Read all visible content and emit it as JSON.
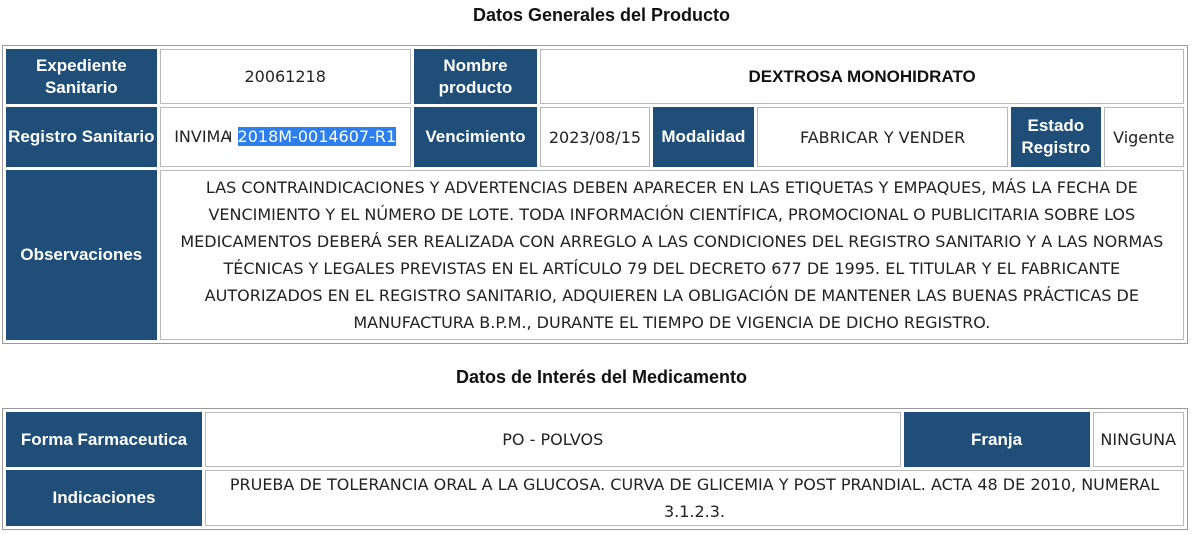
{
  "general": {
    "title": "Datos Generales del Producto",
    "expediente_label": "Expediente Sanitario",
    "expediente_value": "20061218",
    "nombre_label": "Nombre producto",
    "nombre_value": "DEXTROSA MONOHIDRATO",
    "registro_label": "Registro Sanitario",
    "registro_prefix": "INVIMA",
    "registro_selected": "2018M-0014607-R1",
    "vencimiento_label": "Vencimiento",
    "vencimiento_value": "2023/08/15",
    "modalidad_label": "Modalidad",
    "modalidad_value": "FABRICAR Y VENDER",
    "estado_label": "Estado Registro",
    "estado_value": "Vigente",
    "observaciones_label": "Observaciones",
    "observaciones_value": "LAS CONTRAINDICACIONES Y ADVERTENCIAS DEBEN APARECER EN LAS ETIQUETAS Y EMPAQUES, MÁS LA FECHA DE VENCIMIENTO Y EL NÚMERO DE LOTE. TODA INFORMACIÓN CIENTÍFICA, PROMOCIONAL O PUBLICITARIA SOBRE LOS MEDICAMENTOS DEBERÁ SER REALIZADA CON ARREGLO A LAS CONDICIONES DEL REGISTRO SANITARIO Y A LAS NORMAS TÉCNICAS Y LEGALES PREVISTAS EN EL ARTÍCULO 79 DEL DECRETO 677 DE 1995. EL TITULAR Y EL FABRICANTE AUTORIZADOS EN EL REGISTRO SANITARIO, ADQUIEREN LA OBLIGACIÓN DE MANTENER LAS BUENAS PRÁCTICAS DE MANUFACTURA B.P.M., DURANTE EL TIEMPO DE VIGENCIA DE DICHO REGISTRO."
  },
  "interes": {
    "title": "Datos de Interés del Medicamento",
    "forma_label": "Forma Farmaceutica",
    "forma_value": "PO - POLVOS",
    "franja_label": "Franja",
    "franja_value": "NINGUNA",
    "indicaciones_label": "Indicaciones",
    "indicaciones_value": "PRUEBA DE TOLERANCIA ORAL A LA GLUCOSA. CURVA DE GLICEMIA Y POST PRANDIAL. ACTA 48 DE 2010, NUMERAL 3.1.2.3."
  },
  "colors": {
    "header_bg": "#1f4e79",
    "selection": "#2d7ff0"
  },
  "icons": {
    "text_cursor": "text-cursor-icon"
  }
}
